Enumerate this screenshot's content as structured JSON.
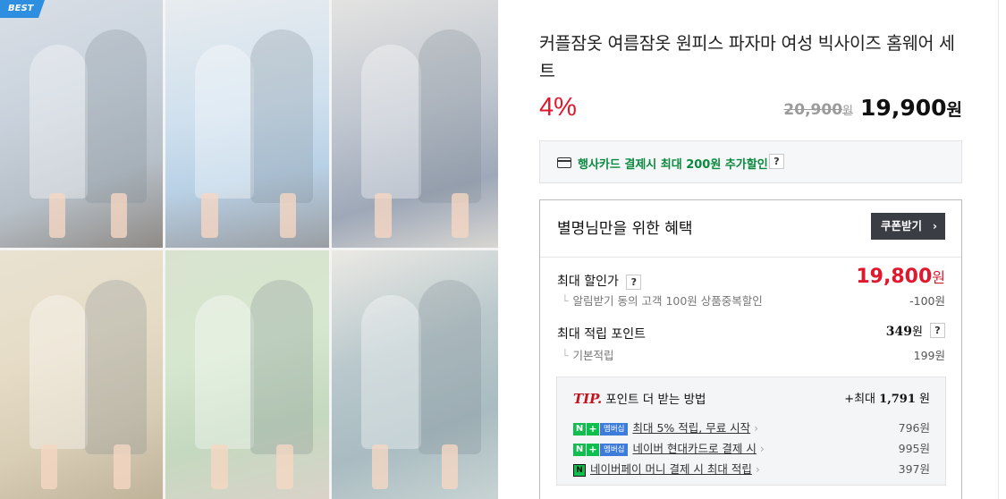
{
  "gallery": {
    "badge": "BEST",
    "photos": [
      "photo-1",
      "photo-2",
      "photo-3",
      "photo-4",
      "photo-5",
      "photo-6"
    ]
  },
  "product": {
    "title": "커플잠옷 여름잠옷 원피스 파자마 여성 빅사이즈 홈웨어 세트",
    "discount": "4%",
    "original_price": "20,900",
    "original_unit": "원",
    "price": "19,900",
    "price_unit": "원"
  },
  "card_promo": {
    "icon": "credit-card-icon",
    "text": "행사카드 결제시 최대 200원 추가할인",
    "help": "?"
  },
  "benefit": {
    "heading": "별명님만을 위한 혜택",
    "coupon_label": "쿠폰받기",
    "coupon_chevron": "›",
    "max_discount_label": "최대 할인가",
    "max_discount_help": "?",
    "max_discount_value": "19,800",
    "max_discount_unit": "원",
    "max_discount_sub": "알림받기 동의 고객 100원 상품중복할인",
    "max_discount_sub_value": "-100원",
    "points_label": "최대 적립 포인트",
    "points_value": "349",
    "points_unit": "원",
    "points_help": "?",
    "points_sub": "기본적립",
    "points_sub_value": "199원"
  },
  "tip": {
    "tip_word": "TIP.",
    "title": "포인트 더 받는 방법",
    "max_prefix": "+최대",
    "max_value": "1,791",
    "max_unit": "원",
    "membership_badge": "멤버십",
    "items": [
      {
        "text": "최대 5% 적립, 무료 시작",
        "value": "796원"
      },
      {
        "text": "네이버 현대카드로 결제 시",
        "value": "995원"
      },
      {
        "text": "네이버페이 머니 결제 시 최대 적립",
        "value": "397원"
      }
    ]
  },
  "colors": {
    "discount_red": "#e0182e",
    "promo_green": "#0a8a3e",
    "badge_blue": "#2e8ee0",
    "coupon_dark": "#3b3d45"
  }
}
